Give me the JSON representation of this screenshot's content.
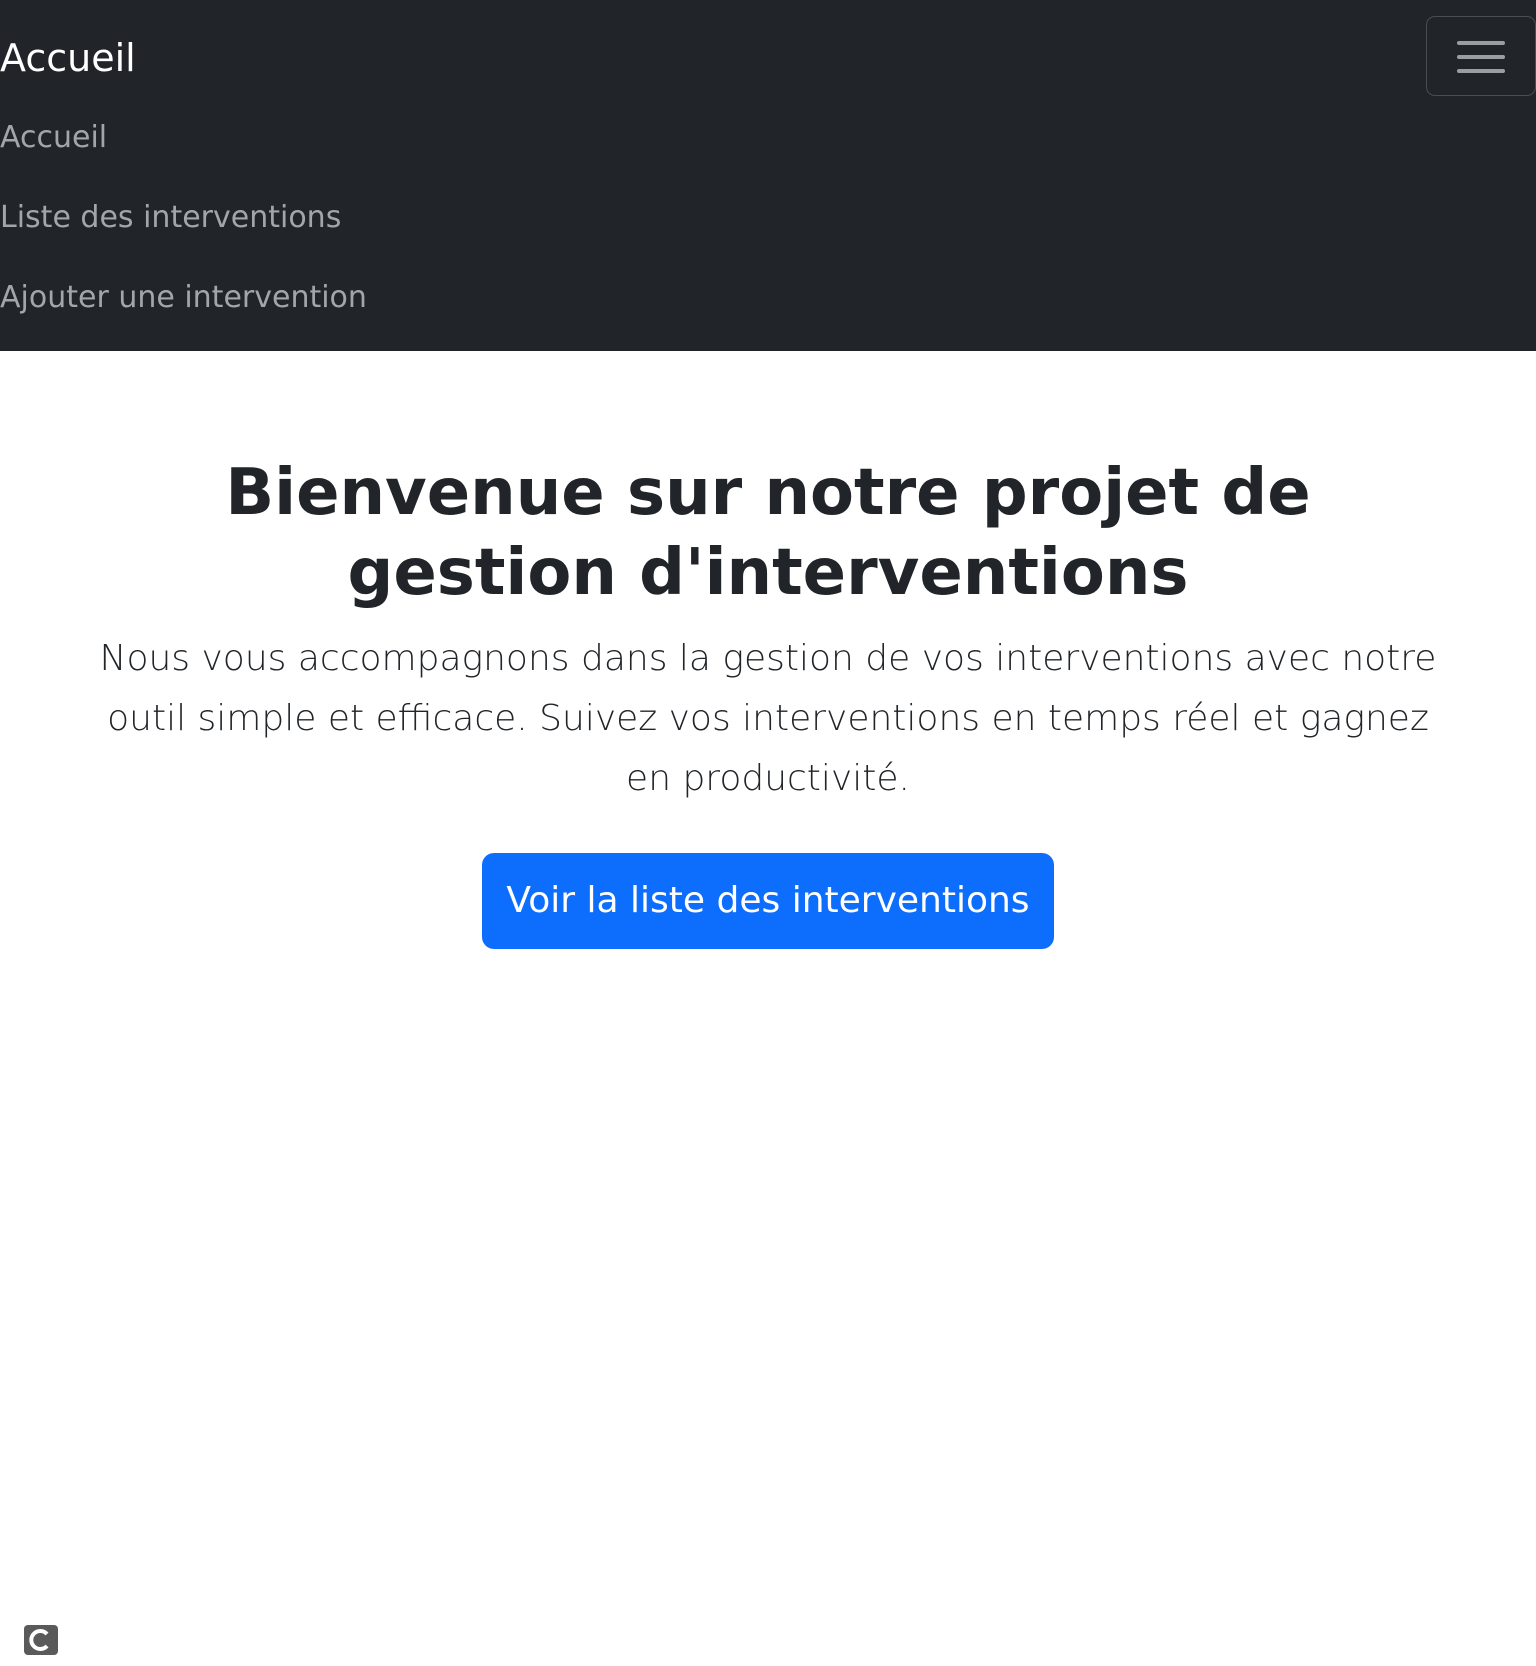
{
  "navbar": {
    "brand": "Accueil",
    "toggler_icon": "hamburger-menu-icon",
    "links": [
      {
        "label": "Accueil"
      },
      {
        "label": "Liste des interventions"
      },
      {
        "label": "Ajouter une intervention"
      }
    ]
  },
  "hero": {
    "title": "Bienvenue sur notre projet de gestion d'interventions",
    "lead": "Nous vous accompagnons dans la gestion de vos interventions avec notre outil simple et efficace. Suivez vos interventions en temps réel et gagnez en productivité.",
    "button_label": "Voir la liste des interventions"
  },
  "corner_icon": "c-logo-icon",
  "colors": {
    "navbar_bg": "#212529",
    "brand_text": "#ffffff",
    "nav_link_text": "#a2a5a9",
    "primary_button": "#0d6efd",
    "body_text": "#212529"
  }
}
